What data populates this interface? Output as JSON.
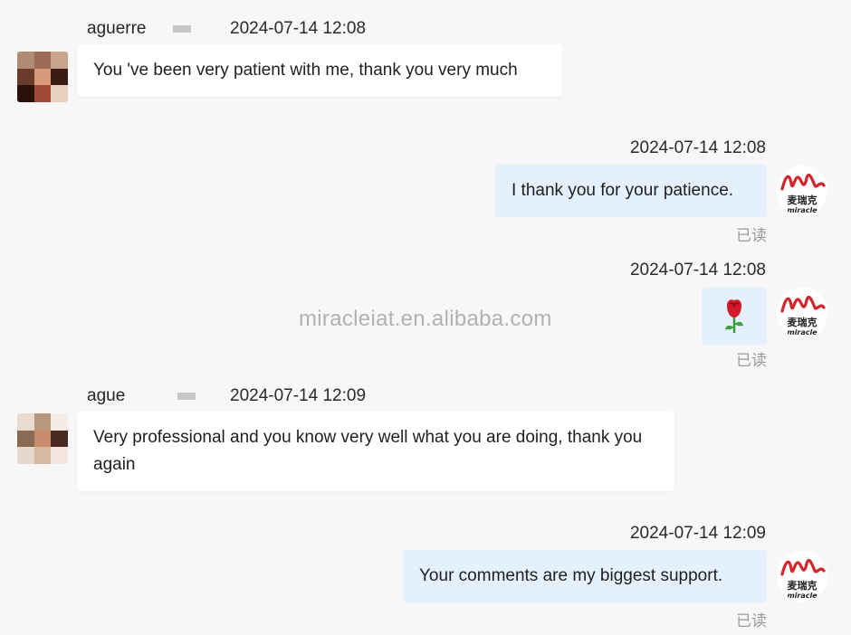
{
  "watermark": "miracleiat.en.alibaba.com",
  "messages": [
    {
      "direction": "incoming",
      "sender": "aguerre",
      "time": "2024-07-14 12:08",
      "text": "You 've been very patient with me, thank you very much"
    },
    {
      "direction": "outgoing",
      "time": "2024-07-14 12:08",
      "text": "I thank you for your patience.",
      "status": "已读"
    },
    {
      "direction": "outgoing",
      "time": "2024-07-14 12:08",
      "emoji": "rose",
      "status": "已读"
    },
    {
      "direction": "incoming",
      "sender": "ague",
      "time": "2024-07-14 12:09",
      "text": "Very professional and you know very well what you are doing, thank you again"
    },
    {
      "direction": "outgoing",
      "time": "2024-07-14 12:09",
      "text": "Your comments are my biggest support.",
      "status": "已读"
    }
  ],
  "seller_logo": {
    "brand_text": "miracle",
    "chinese_text": "麦瑞克",
    "accent": "#d4252b"
  },
  "colors": {
    "incoming_bubble": "#ffffff",
    "outgoing_bubble": "#e5f0ff",
    "background": "#f7f7f7",
    "read_status": "#9a9a9a"
  }
}
